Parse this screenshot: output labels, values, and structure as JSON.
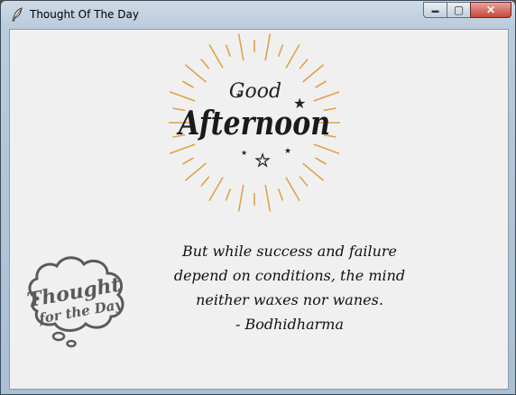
{
  "window": {
    "title": "Thought Of The Day",
    "buttons": {
      "minimize": "▬",
      "maximize": "▢",
      "close": "✕"
    }
  },
  "greeting": {
    "line1": "Good",
    "line2": "Afternoon",
    "ray_color": "#e0a24a"
  },
  "quote": {
    "lines": [
      "But while success and failure",
      "depend on conditions, the mind",
      "neither waxes nor wanes."
    ],
    "author": "- Bodhidharma"
  },
  "logo": {
    "line1": "Thought",
    "line2": "for the Day",
    "color": "#5a5a5a"
  }
}
